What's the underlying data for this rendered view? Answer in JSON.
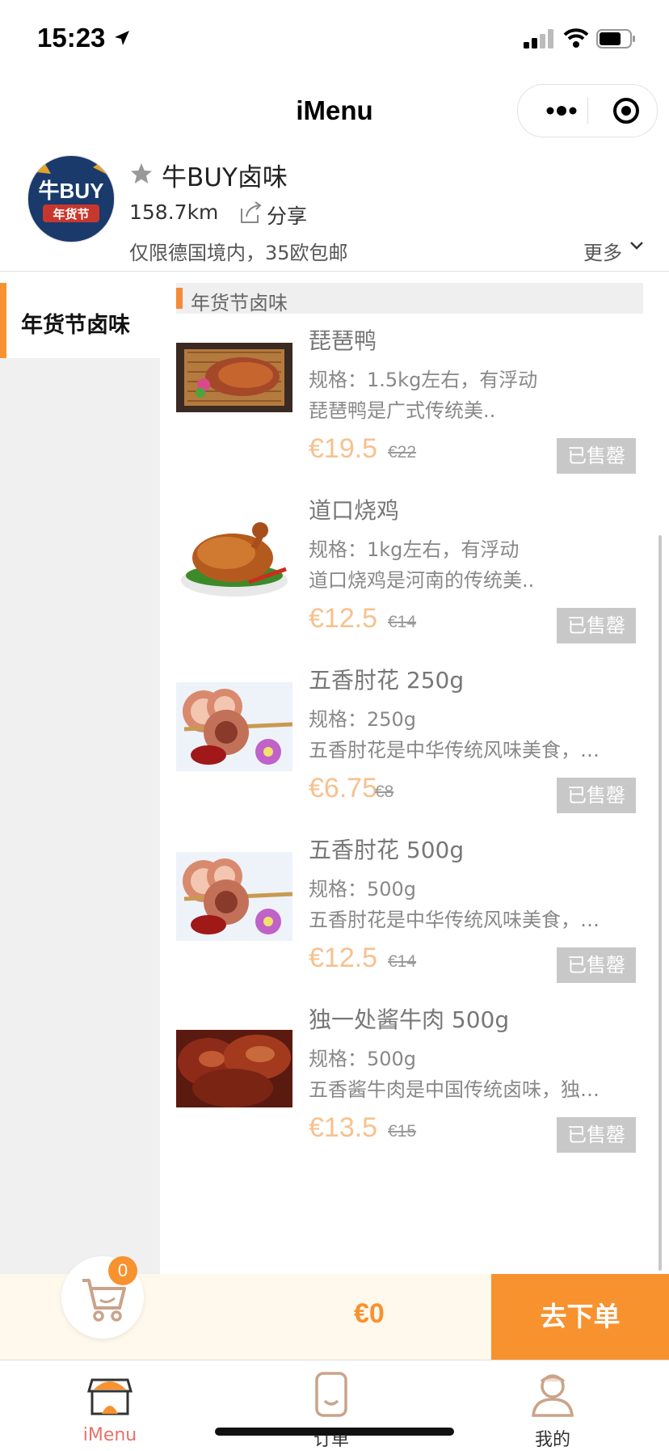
{
  "status_bar": {
    "time": "15:23"
  },
  "nav": {
    "title": "iMenu"
  },
  "shop": {
    "name": "牛BUY卤味",
    "distance": "158.7km",
    "share_label": "分享",
    "notice": "仅限德国境内，35欧包邮",
    "more_label": "更多",
    "logo_text_top": "牛BUY",
    "logo_text_bottom": "年货节"
  },
  "categories": [
    {
      "label": "年货节卤味",
      "active": true
    }
  ],
  "section": {
    "title": "年货节卤味"
  },
  "items": [
    {
      "name": "琵琶鸭",
      "spec": "规格：1.5kg左右，有浮动",
      "desc": "琵琶鸭是广式传统美..",
      "price": "€19.5",
      "original_price": "€22",
      "status": "已售罄"
    },
    {
      "name": "道口烧鸡",
      "spec": "规格：1kg左右，有浮动",
      "desc": "道口烧鸡是河南的传统美..",
      "price": "€12.5",
      "original_price": "€14",
      "status": "已售罄"
    },
    {
      "name": "五香肘花 250g",
      "spec": "规格：250g",
      "desc": "五香肘花是中华传统风味美食，…",
      "price": "€6.75",
      "original_price": "€8",
      "status": "已售罄"
    },
    {
      "name": "五香肘花 500g",
      "spec": "规格：500g",
      "desc": "五香肘花是中华传统风味美食，…",
      "price": "€12.5",
      "original_price": "€14",
      "status": "已售罄"
    },
    {
      "name": "独一处酱牛肉 500g",
      "spec": "规格：500g",
      "desc": "五香酱牛肉是中国传统卤味，独…",
      "price": "€13.5",
      "original_price": "€15",
      "status": "已售罄"
    }
  ],
  "cart": {
    "count": "0",
    "total": "€0",
    "order_button": "去下单"
  },
  "tabs": [
    {
      "label": "iMenu",
      "icon": "shop-icon",
      "active": true
    },
    {
      "label": "订单",
      "icon": "order-icon",
      "active": false
    },
    {
      "label": "我的",
      "icon": "profile-icon",
      "active": false
    }
  ],
  "colors": {
    "accent": "#f7922f",
    "active_tab": "#e8716a",
    "sold_out": "#c8c8c8",
    "price": "#f7c18f"
  }
}
